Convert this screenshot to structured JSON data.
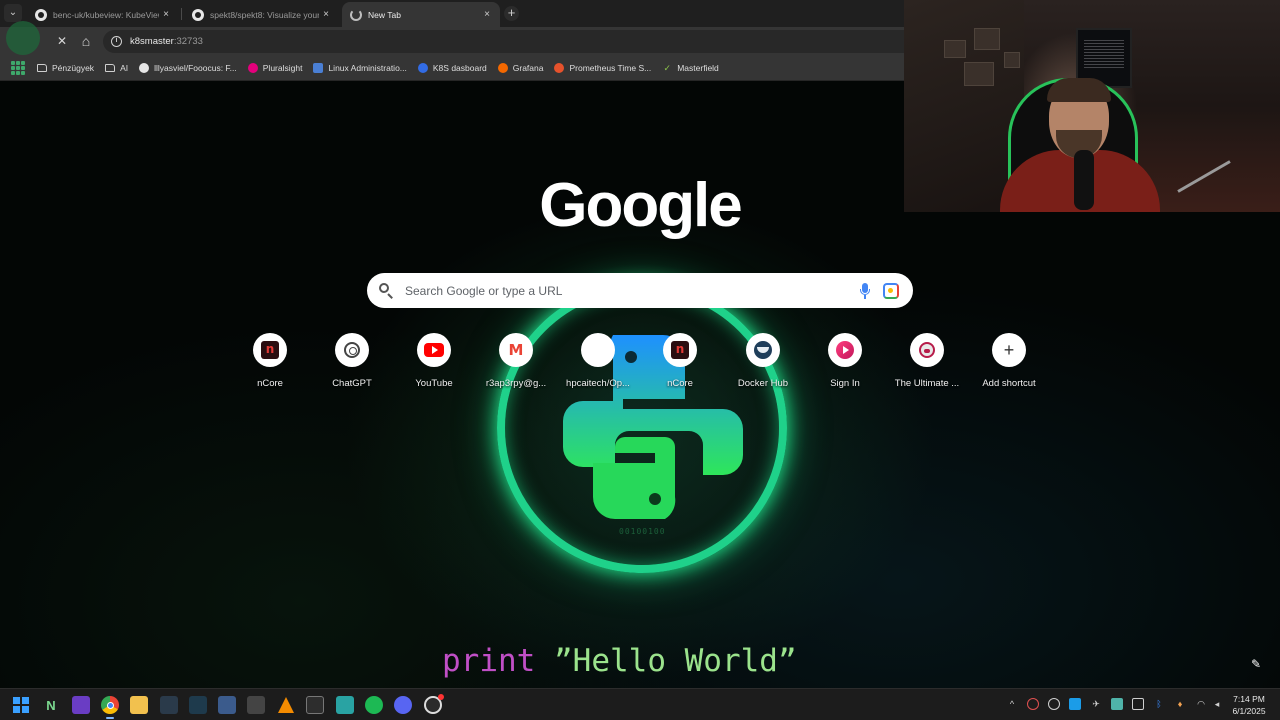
{
  "browser": {
    "tabs": [
      {
        "title": "benc-uk/kubeview: KubeView - ",
        "icon": "github-icon",
        "active": false
      },
      {
        "title": "spekt8/spekt8: Visualize your K",
        "icon": "github-icon",
        "active": false
      },
      {
        "title": "New Tab",
        "icon": "loading-spinner-icon",
        "active": true
      }
    ],
    "new_tab_symbol": "+",
    "close_symbol": "×",
    "toolbar": {
      "stop_symbol": "✕",
      "home_symbol": "⌂",
      "url_host": "k8smaster",
      "url_port": ":32733"
    },
    "bookmarks": [
      {
        "label": "Pénzügyek",
        "icon": "folder-icon"
      },
      {
        "label": "AI",
        "icon": "folder-icon"
      },
      {
        "label": "lllyasviel/Fooocus: F...",
        "icon": "github-icon"
      },
      {
        "label": "Pluralsight",
        "icon": "pluralsight-icon"
      },
      {
        "label": "Linux Administratio...",
        "icon": "document-icon"
      },
      {
        "label": "K8S dasboard",
        "icon": "kubernetes-icon"
      },
      {
        "label": "Grafana",
        "icon": "grafana-icon"
      },
      {
        "label": "Prometheus Time S...",
        "icon": "prometheus-icon"
      },
      {
        "label": "Masterfield",
        "icon": "checkmark-icon"
      }
    ]
  },
  "newtab": {
    "logo_text": "Google",
    "search_placeholder": "Search Google or type a URL",
    "shortcuts": [
      {
        "label": "nCore",
        "icon": "ncore-icon"
      },
      {
        "label": "ChatGPT",
        "icon": "chatgpt-icon"
      },
      {
        "label": "YouTube",
        "icon": "youtube-icon"
      },
      {
        "label": "r3ap3rpy@g...",
        "icon": "gmail-icon"
      },
      {
        "label": "hpcaitech/Op...",
        "icon": "github-icon"
      },
      {
        "label": "nCore",
        "icon": "ncore-icon"
      },
      {
        "label": "Docker Hub",
        "icon": "docker-icon"
      },
      {
        "label": "Sign In",
        "icon": "signin-icon"
      },
      {
        "label": "The Ultimate ...",
        "icon": "ultimate-icon"
      },
      {
        "label": "Add shortcut",
        "icon": "add-icon"
      }
    ],
    "ncore_glyph": "n",
    "gmail_glyph": "M",
    "add_glyph": "+",
    "wallpaper_code_keyword": "print",
    "wallpaper_code_string": "”Hello World”",
    "wallpaper_small_text": "00100100",
    "edit_symbol": "✎"
  },
  "taskbar": {
    "apps": [
      "windows-start-icon",
      "n-app-icon",
      "visual-studio-icon",
      "chrome-icon",
      "file-explorer-icon",
      "app-icon",
      "terminal-icon",
      "save-icon",
      "translate-icon",
      "vlc-icon",
      "console-icon",
      "cube-icon",
      "spotify-icon",
      "discord-icon",
      "obs-icon"
    ],
    "tray_up_symbol": "^",
    "time": "7:14 PM",
    "date": "6/1/2025"
  },
  "colors": {
    "tab_bg": "#1f1f1f",
    "toolbar_bg": "#353535",
    "accent_green": "#1fd18a",
    "code_keyword": "#c04fc6",
    "code_string": "#9be38c"
  }
}
